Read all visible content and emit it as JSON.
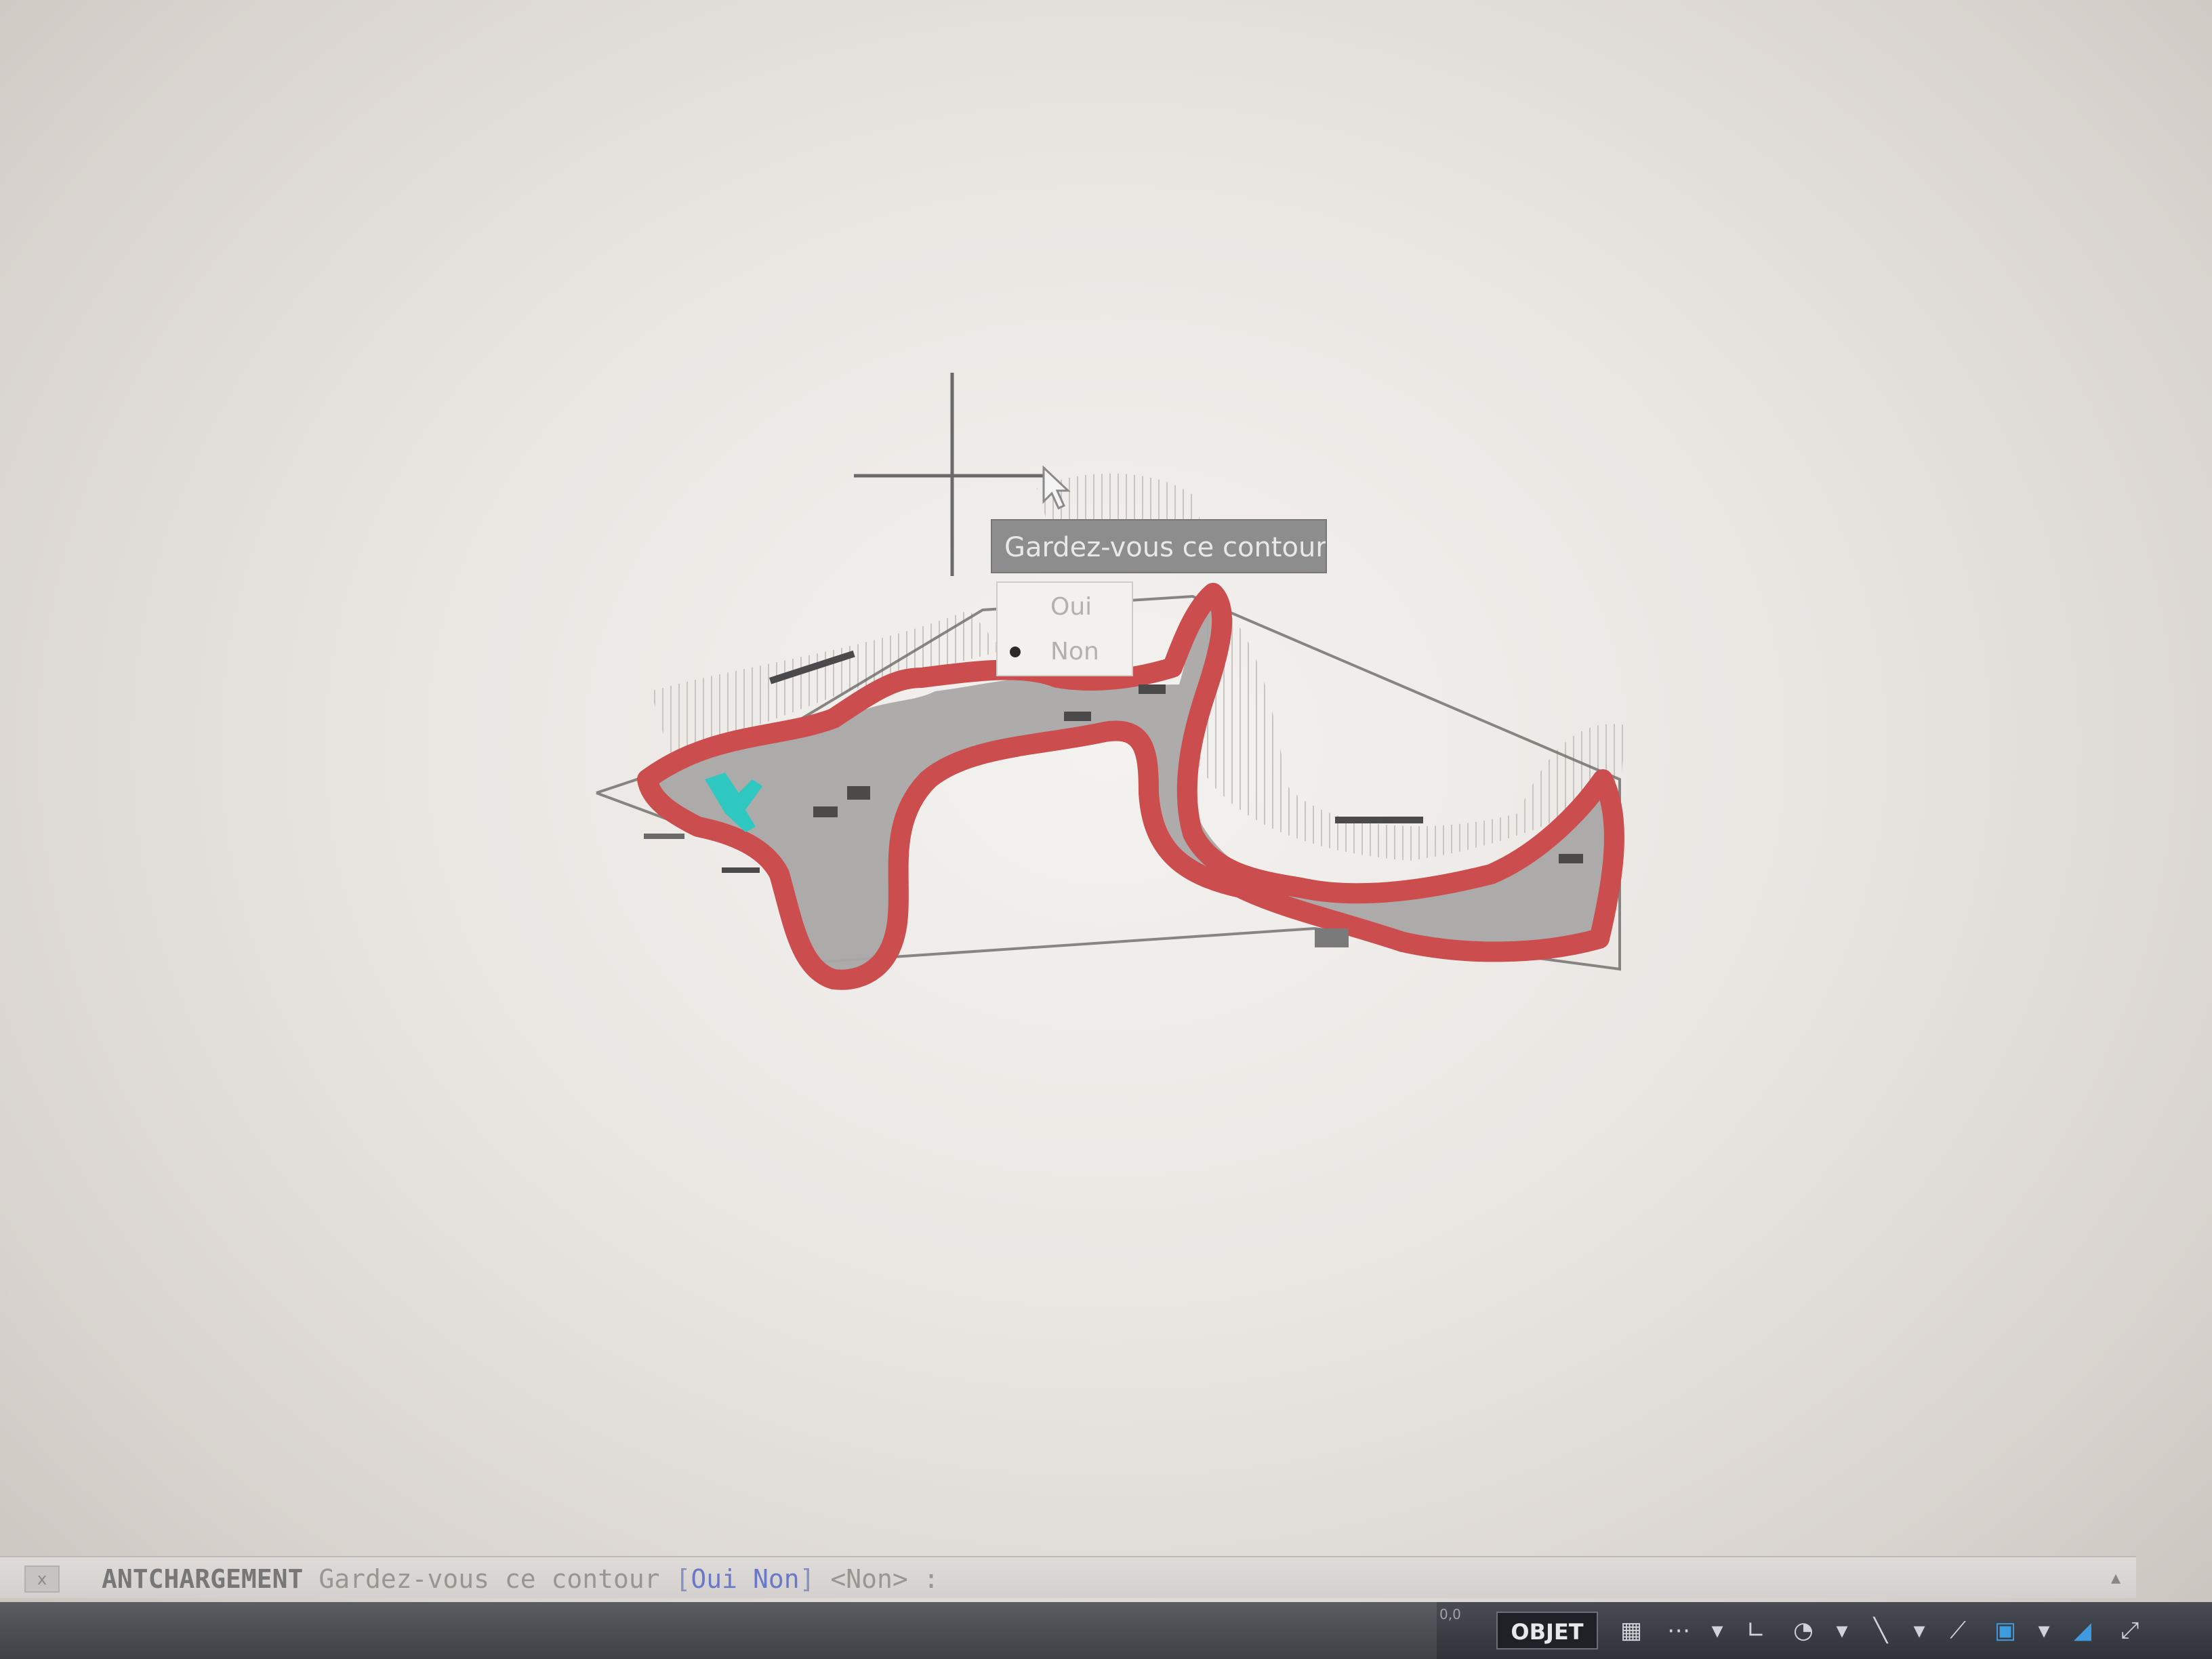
{
  "prompt": {
    "tooltip_text": "Gardez-vous ce contour",
    "options": [
      {
        "label": "Oui",
        "selected": false
      },
      {
        "label": "Non",
        "selected": true
      }
    ]
  },
  "command_line": {
    "close_label": "x",
    "command_name": "ANTCHARGEMENT",
    "question": "Gardez-vous ce contour",
    "bracket_open": "[",
    "option_oui": "Oui",
    "option_non": "Non",
    "bracket_close": "]",
    "default_value": "<Non> :",
    "scroll_icon": "▴"
  },
  "status_bar": {
    "coords_label": "0,0",
    "objet_label": "OBJET",
    "icons": [
      {
        "name": "grid-icon",
        "glyph": "▦",
        "active": false
      },
      {
        "name": "snap-icon",
        "glyph": "⋯",
        "active": false
      },
      {
        "name": "dropdown-icon",
        "glyph": "▾",
        "active": false
      },
      {
        "name": "ortho-icon",
        "glyph": "∟",
        "active": false
      },
      {
        "name": "polar-icon",
        "glyph": "◔",
        "active": false
      },
      {
        "name": "dropdown-icon",
        "glyph": "▾",
        "active": false
      },
      {
        "name": "osnap-icon",
        "glyph": "╲",
        "active": false
      },
      {
        "name": "dropdown-icon",
        "glyph": "▾",
        "active": false
      },
      {
        "name": "annotation-icon",
        "glyph": "⟋",
        "active": false
      },
      {
        "name": "workspace-icon",
        "glyph": "▣",
        "active": true
      },
      {
        "name": "dropdown-icon",
        "glyph": "▾",
        "active": false
      },
      {
        "name": "lock-icon",
        "glyph": "◢",
        "active": true
      },
      {
        "name": "fullscreen-icon",
        "glyph": "⤢",
        "active": false
      }
    ]
  },
  "colors": {
    "contour": "#cc4d4d",
    "fill": "#a8a8a8",
    "highlight": "#2fc8c0"
  }
}
